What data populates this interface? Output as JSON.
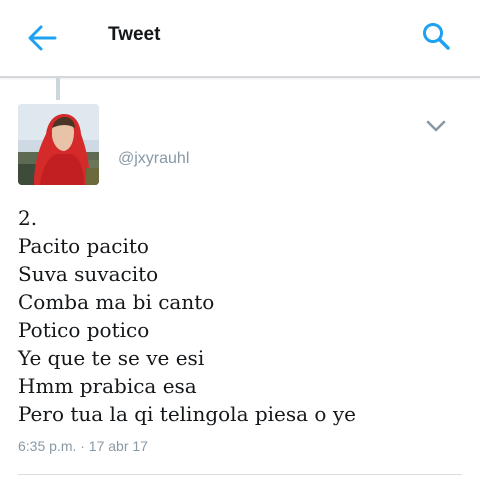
{
  "colors": {
    "accent": "#1da1f2",
    "text": "#14171a",
    "secondary": "#8899a6"
  },
  "header": {
    "back_icon": "arrow-left-icon",
    "title": "Tweet",
    "search_icon": "search-icon"
  },
  "tweet": {
    "handle": "@jxyrauhl",
    "menu_icon": "chevron-down-icon",
    "lines": [
      "2.",
      "Pacito pacito",
      "Suva suvacito",
      "Comba ma bi canto",
      "Potico potico",
      "Ye que te se ve esi",
      "Hmm prabica esa",
      "Pero tua la qi telingola piesa o ye"
    ],
    "timestamp": "6:35 p.m. · 17 abr 17"
  }
}
